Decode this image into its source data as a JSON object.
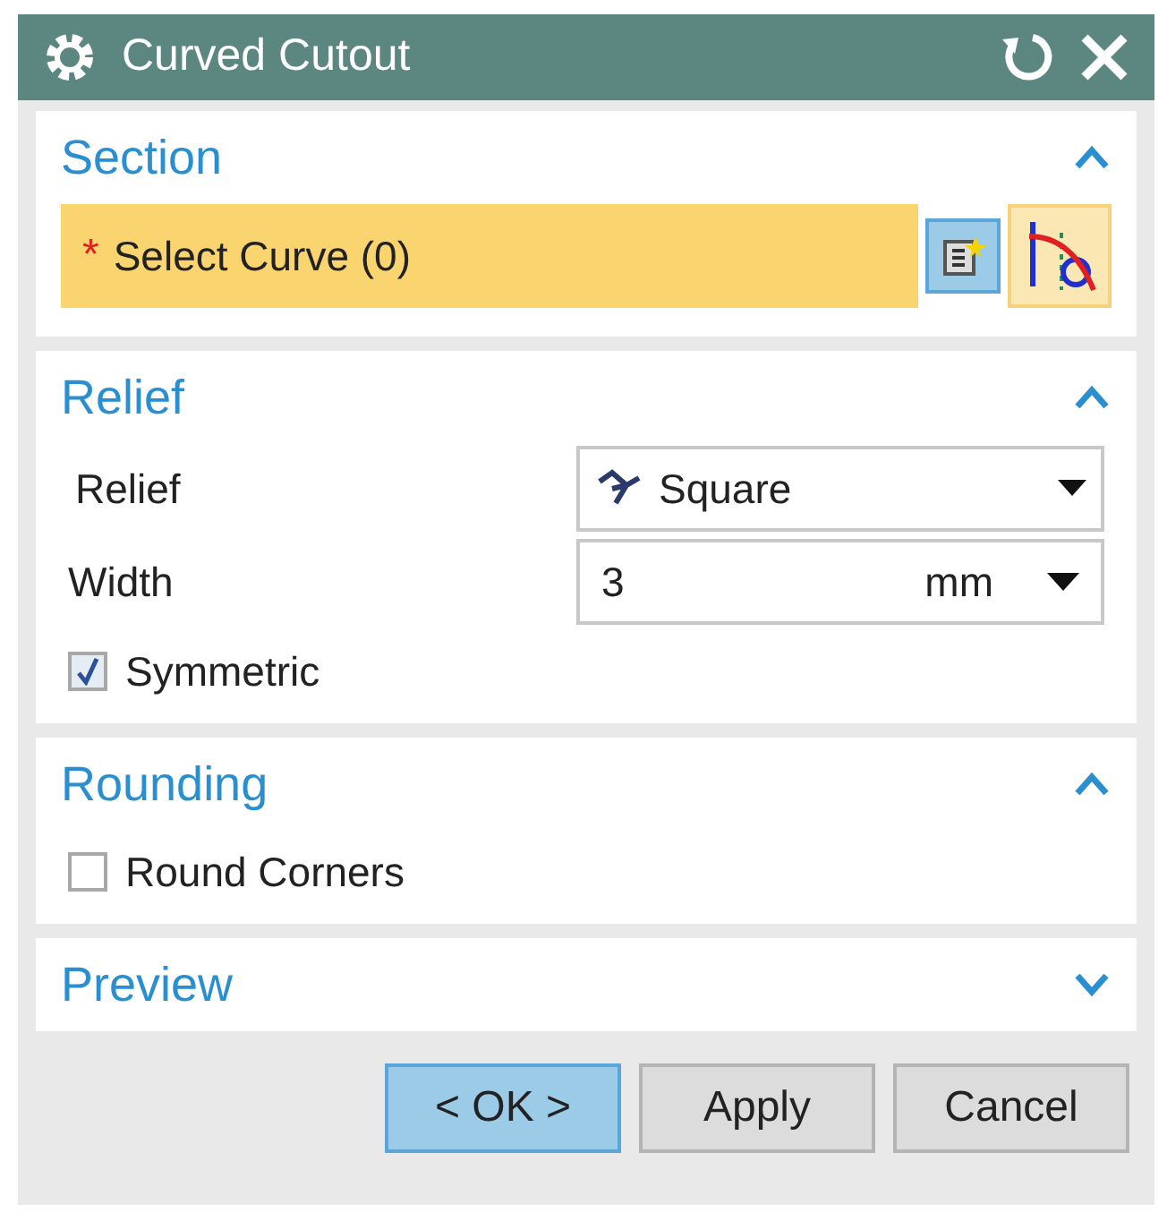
{
  "window": {
    "title": "Curved Cutout"
  },
  "sections": [
    {
      "kind": "selection",
      "title": "Section",
      "expanded": true,
      "required_mark": "*",
      "label": "Select Curve (0)"
    },
    {
      "kind": "form",
      "title": "Relief",
      "expanded": true,
      "rows": [
        {
          "kind": "dropdown",
          "label": "Relief",
          "value": "Square"
        },
        {
          "kind": "number",
          "label": "Width",
          "value": "3",
          "unit": "mm"
        },
        {
          "kind": "checkbox",
          "label": "Symmetric",
          "checked": true
        }
      ]
    },
    {
      "kind": "form",
      "title": "Rounding",
      "expanded": true,
      "rows": [
        {
          "kind": "checkbox",
          "label": "Round Corners",
          "checked": false
        }
      ]
    },
    {
      "kind": "form",
      "title": "Preview",
      "expanded": false
    }
  ],
  "buttons": [
    {
      "label": "< OK >",
      "selected": true
    },
    {
      "label": "Apply",
      "selected": false
    },
    {
      "label": "Cancel",
      "selected": false
    }
  ]
}
